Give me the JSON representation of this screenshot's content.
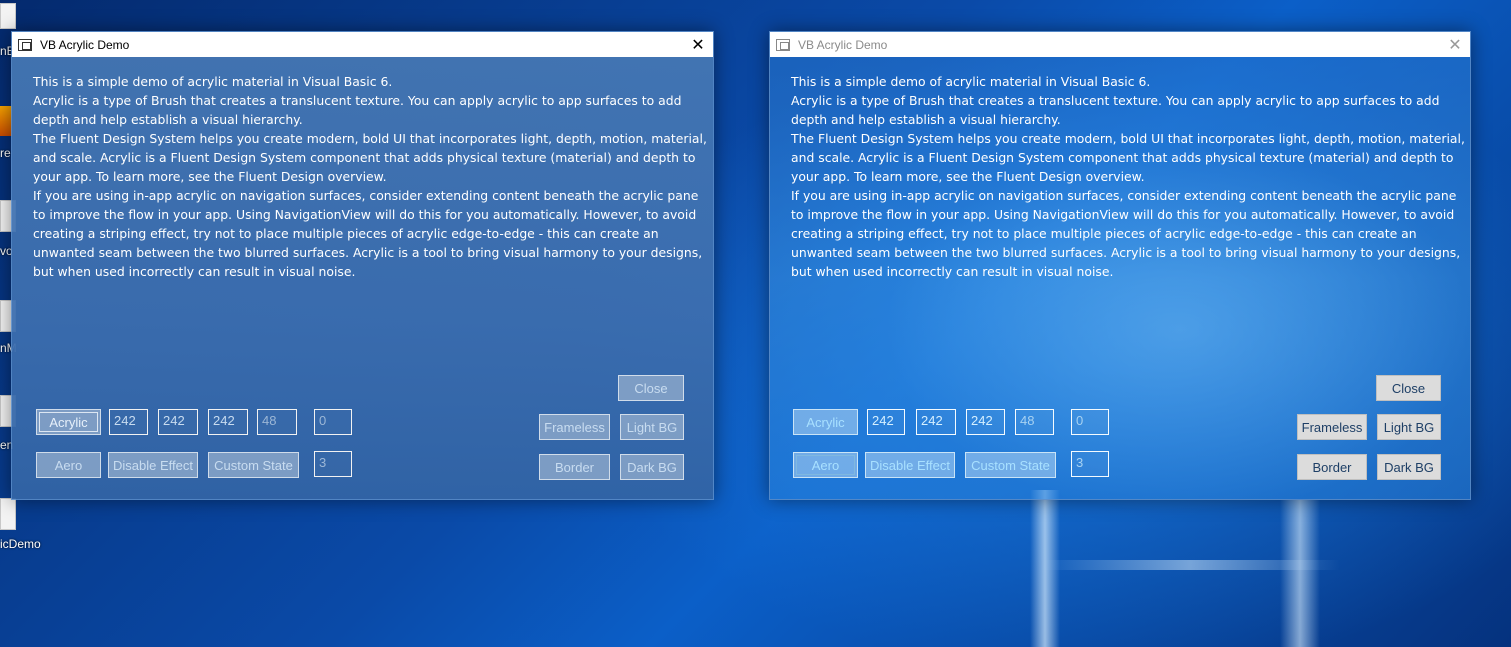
{
  "desktop": {
    "icon_label_fragments": [
      "nB",
      "re",
      "vo",
      "nM",
      "en",
      "icDemo"
    ]
  },
  "windows": [
    {
      "title": "VB Acrylic Demo",
      "state": "active",
      "description": [
        "This is a simple demo of acrylic material in Visual Basic 6.",
        "Acrylic is a type of Brush that creates a translucent texture. You can apply acrylic to app surfaces to add depth and help establish a visual hierarchy.",
        "The Fluent Design System helps you create modern, bold UI that incorporates light, depth, motion, material, and scale. Acrylic is a Fluent Design System component that adds physical texture (material) and depth to your app. To learn more, see the Fluent Design overview.",
        "If you are using in-app acrylic on navigation surfaces, consider extending content beneath the acrylic pane to improve the flow in your app. Using NavigationView will do this for you automatically. However, to avoid creating a striping effect, try not to place multiple pieces of acrylic edge-to-edge - this can create an unwanted seam between the two blurred surfaces. Acrylic is a tool to bring visual harmony to your designs, but when used incorrectly can result in visual noise."
      ],
      "buttons": {
        "acrylic": "Acrylic",
        "aero": "Aero",
        "disable_effect": "Disable Effect",
        "custom_state": "Custom State",
        "close": "Close",
        "frameless": "Frameless",
        "light_bg": "Light BG",
        "border": "Border",
        "dark_bg": "Dark BG"
      },
      "fields": {
        "r": "242",
        "g": "242",
        "b": "242",
        "alpha": "48",
        "value1": "0",
        "state": "3"
      }
    },
    {
      "title": "VB Acrylic Demo",
      "state": "inactive",
      "description": [
        "This is a simple demo of acrylic material in Visual Basic 6.",
        "Acrylic is a type of Brush that creates a translucent texture. You can apply acrylic to app surfaces to add depth and help establish a visual hierarchy.",
        "The Fluent Design System helps you create modern, bold UI that incorporates light, depth, motion, material, and scale. Acrylic is a Fluent Design System component that adds physical texture (material) and depth to your app. To learn more, see the Fluent Design overview.",
        "If you are using in-app acrylic on navigation surfaces, consider extending content beneath the acrylic pane to improve the flow in your app. Using NavigationView will do this for you automatically. However, to avoid creating a striping effect, try not to place multiple pieces of acrylic edge-to-edge - this can create an unwanted seam between the two blurred surfaces. Acrylic is a tool to bring visual harmony to your designs, but when used incorrectly can result in visual noise."
      ],
      "buttons": {
        "acrylic": "Acrylic",
        "aero": "Aero",
        "disable_effect": "Disable Effect",
        "custom_state": "Custom State",
        "close": "Close",
        "frameless": "Frameless",
        "light_bg": "Light BG",
        "border": "Border",
        "dark_bg": "Dark BG"
      },
      "fields": {
        "r": "242",
        "g": "242",
        "b": "242",
        "alpha": "48",
        "value1": "0",
        "state": "3"
      }
    }
  ],
  "icons": {
    "window_icon": "app-window-icon",
    "close_icon": "close-icon",
    "close_glyph": "✕"
  }
}
